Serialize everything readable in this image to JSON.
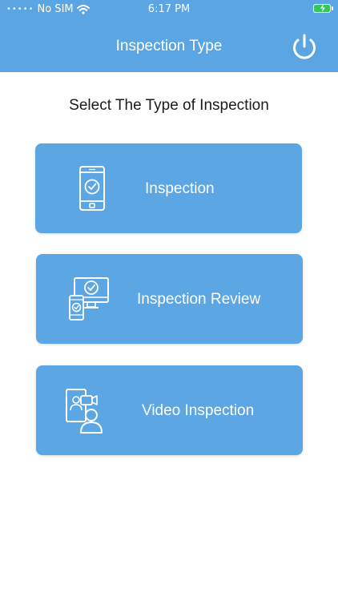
{
  "status_bar": {
    "carrier": "No SIM",
    "time": "6:17 PM"
  },
  "header": {
    "title": "Inspection Type"
  },
  "main": {
    "heading": "Select The Type of Inspection",
    "options": [
      {
        "label": "Inspection",
        "icon": "phone-check-icon"
      },
      {
        "label": "Inspection Review",
        "icon": "monitor-phone-check-icon"
      },
      {
        "label": "Video Inspection",
        "icon": "video-call-icon"
      }
    ]
  },
  "colors": {
    "accent": "#5aa5e2",
    "card": "#5ca6e4",
    "battery": "#34c759"
  }
}
